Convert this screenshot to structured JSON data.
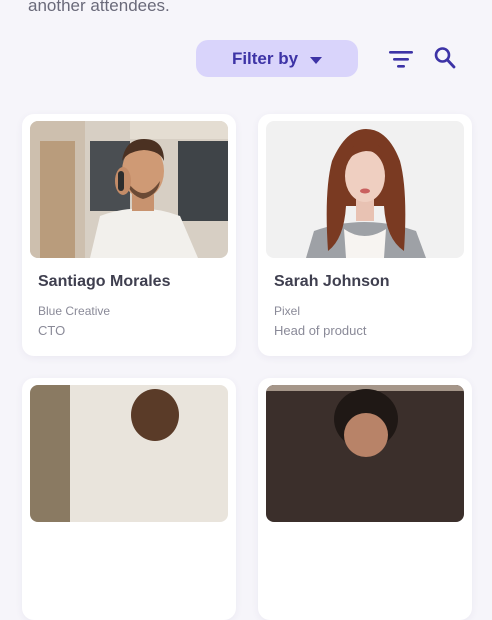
{
  "intro_text": "another attendees.",
  "toolbar": {
    "filter_label": "Filter by",
    "filter_icon": "filter-lines-icon",
    "search_icon": "search-icon"
  },
  "colors": {
    "accent": "#3d33a6",
    "accent_bg": "#d9d4fb",
    "page_bg": "#f6f5fa"
  },
  "attendees": [
    {
      "name": "Santiago Morales",
      "company": "Blue Creative",
      "role": "CTO"
    },
    {
      "name": "Sarah Johnson",
      "company": "Pixel",
      "role": "Head of product"
    }
  ]
}
